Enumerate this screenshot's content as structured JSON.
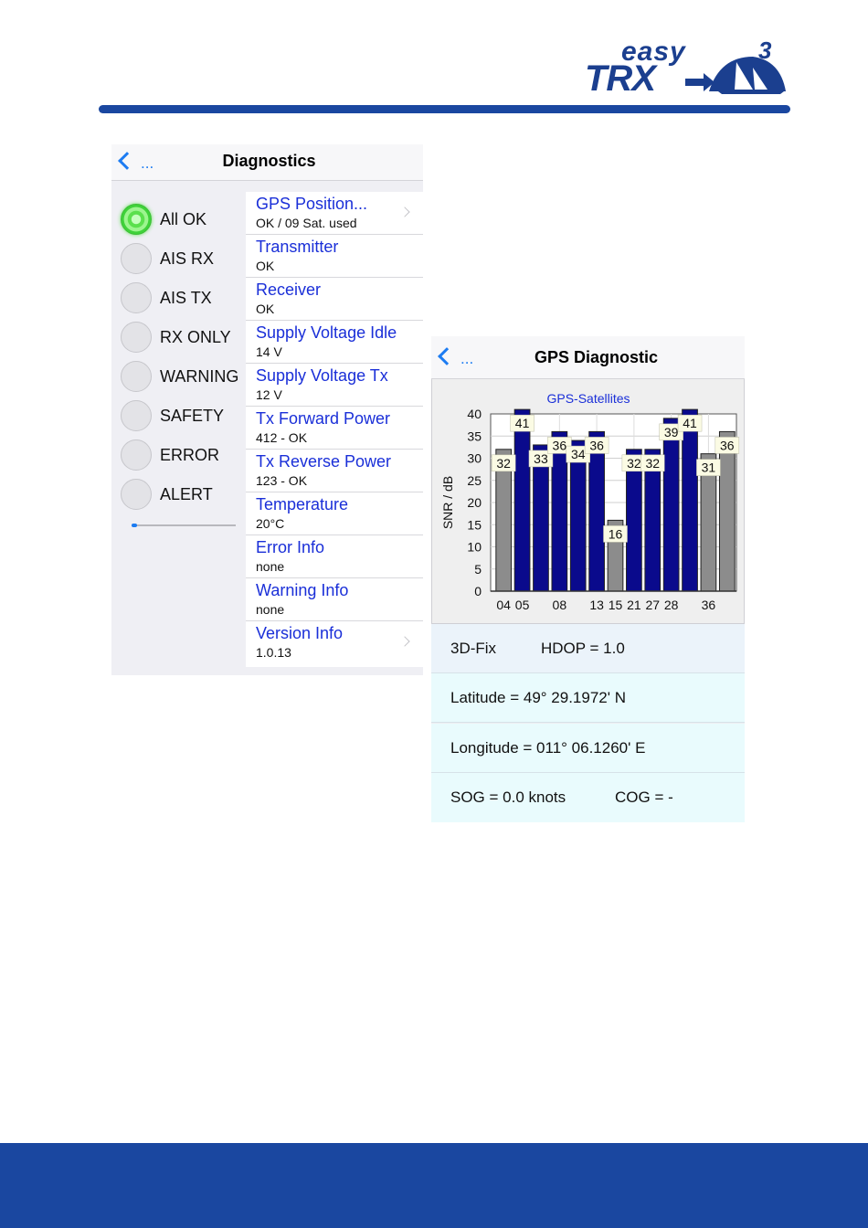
{
  "logo": {
    "word_top": "easy",
    "word_main": "TRX",
    "version_mark": "3"
  },
  "colors": {
    "brand_blue": "#1a47a0",
    "ios_blue": "#1d7cf2",
    "link_blue": "#1a2fd8",
    "bar_blue": "#0a0a8c",
    "bar_gray": "#8c8c8c",
    "led_green": "#3fd23a"
  },
  "diagnostics": {
    "back_icon": "chevron-left-icon",
    "back_label": "...",
    "title": "Diagnostics",
    "leds": [
      {
        "label": "All OK",
        "active": true
      },
      {
        "label": "AIS RX",
        "active": false
      },
      {
        "label": "AIS TX",
        "active": false
      },
      {
        "label": "RX ONLY",
        "active": false
      },
      {
        "label": "WARNING",
        "active": false
      },
      {
        "label": "SAFETY",
        "active": false
      },
      {
        "label": "ERROR",
        "active": false
      },
      {
        "label": "ALERT",
        "active": false
      }
    ],
    "progress_fraction": 0.05,
    "items": [
      {
        "title": "GPS Position...",
        "value": "OK / 09 Sat. used",
        "has_disclosure": true
      },
      {
        "title": "Transmitter",
        "value": "OK",
        "has_disclosure": false
      },
      {
        "title": "Receiver",
        "value": "OK",
        "has_disclosure": false
      },
      {
        "title": "Supply Voltage Idle",
        "value": "14 V",
        "has_disclosure": false
      },
      {
        "title": "Supply Voltage Tx",
        "value": "12 V",
        "has_disclosure": false
      },
      {
        "title": "Tx Forward Power",
        "value": "412 - OK",
        "has_disclosure": false
      },
      {
        "title": "Tx Reverse Power",
        "value": "123 - OK",
        "has_disclosure": false
      },
      {
        "title": "Temperature",
        "value": "20°C",
        "has_disclosure": false
      },
      {
        "title": "Error Info",
        "value": "none",
        "has_disclosure": false
      },
      {
        "title": "Warning Info",
        "value": "none",
        "has_disclosure": false
      },
      {
        "title": "Version Info",
        "value": "1.0.13",
        "has_disclosure": true
      }
    ]
  },
  "gps": {
    "back_icon": "chevron-left-icon",
    "back_label": "...",
    "title": "GPS Diagnostic",
    "fix": "3D-Fix",
    "hdop": "HDOP = 1.0",
    "latitude": "Latitude = 49° 29.1972' N",
    "longitude": "Longitude = 011° 06.1260' E",
    "sog": "SOG = 0.0 knots",
    "cog": "COG = -"
  },
  "chart_data": {
    "type": "bar",
    "title": "GPS-Satellites",
    "xlabel": "",
    "ylabel": "SNR / dB",
    "ylim": [
      0,
      40
    ],
    "yticks": [
      0,
      5,
      10,
      15,
      20,
      25,
      30,
      35,
      40
    ],
    "grid": true,
    "x_tick_labels": [
      "04",
      "05",
      "08",
      "13",
      "15",
      "21",
      "27",
      "28",
      "36"
    ],
    "bars": [
      {
        "x": "04",
        "value": 32,
        "used": false
      },
      {
        "x": "05",
        "value": 41,
        "used": true
      },
      {
        "x": "",
        "value": 33,
        "used": true
      },
      {
        "x": "08",
        "value": 36,
        "used": true
      },
      {
        "x": "",
        "value": 34,
        "used": true
      },
      {
        "x": "13",
        "value": 36,
        "used": true
      },
      {
        "x": "15",
        "value": 16,
        "used": false
      },
      {
        "x": "21",
        "value": 32,
        "used": true
      },
      {
        "x": "27",
        "value": 32,
        "used": true
      },
      {
        "x": "28",
        "value": 39,
        "used": true
      },
      {
        "x": "",
        "value": 41,
        "used": true
      },
      {
        "x": "36",
        "value": 31,
        "used": false
      },
      {
        "x": "",
        "value": 36,
        "used": false
      }
    ]
  }
}
